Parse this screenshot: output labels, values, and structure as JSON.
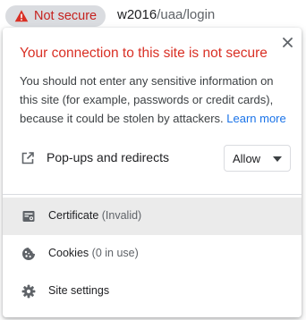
{
  "omnibox": {
    "security_label": "Not secure",
    "security_icon": "warning-triangle-icon",
    "url_host": "w2016",
    "url_path": "/uaa/login"
  },
  "popup": {
    "title": "Your connection to this site is not secure",
    "description": "You should not enter any sensitive information on this site (for example, passwords or credit cards), because it could be stolen by attackers.",
    "learn_more": "Learn more",
    "close_icon": "close-icon",
    "permission": {
      "icon": "external-link-icon",
      "label": "Pop-ups and redirects",
      "value": "Allow"
    },
    "items": [
      {
        "icon": "certificate-icon",
        "label": "Certificate",
        "detail": "(Invalid)"
      },
      {
        "icon": "cookie-icon",
        "label": "Cookies",
        "detail": "(0 in use)"
      },
      {
        "icon": "gear-icon",
        "label": "Site settings",
        "detail": ""
      }
    ]
  },
  "colors": {
    "danger_text": "#d93025",
    "chip_bg": "#dadce0",
    "link": "#1a73e8",
    "hover_bg": "#ebebeb"
  }
}
